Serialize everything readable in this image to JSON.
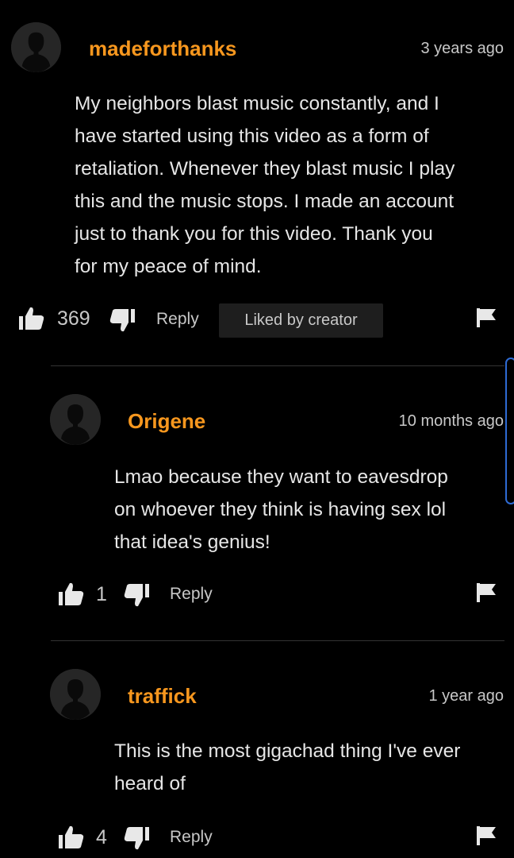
{
  "comments": [
    {
      "username": "madeforthanks",
      "timestamp": "3 years ago",
      "text": "My neighbors blast music constantly, and I\nhave started using this video as a form of\nretaliation. Whenever they blast music I play\nthis and the music stops. I made an account\njust to thank you for this video. Thank you\nfor my peace of mind.",
      "likes": "369",
      "reply_label": "Reply",
      "badge": "Liked by creator"
    },
    {
      "username": "Origene",
      "timestamp": "10 months ago",
      "text": "Lmao because they want to eavesdrop\non whoever they think is having sex lol\nthat idea's genius!",
      "likes": "1",
      "reply_label": "Reply"
    },
    {
      "username": "traffick",
      "timestamp": "1 year ago",
      "text": "This is the most gigachad thing I've ever\nheard of",
      "likes": "4",
      "reply_label": "Reply"
    }
  ],
  "icons": {
    "like": "thumbs-up-icon",
    "dislike": "thumbs-down-icon",
    "flag": "flag-icon",
    "avatar": "default-avatar-icon"
  },
  "colors": {
    "background": "#000000",
    "username": "#f7971e",
    "scroll_indicator": "#2e6bd4"
  }
}
